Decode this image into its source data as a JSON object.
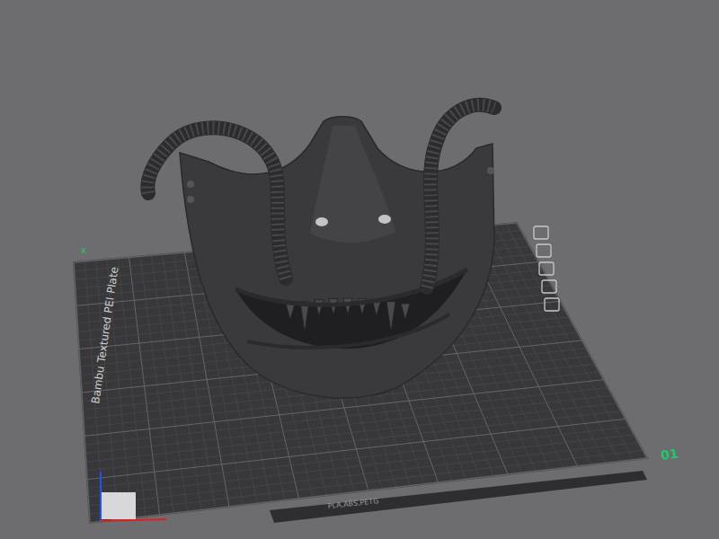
{
  "viewport": {
    "background": "#6d6d70"
  },
  "plate": {
    "name": "Bambu Textured PEI Plate",
    "number": "01",
    "filaments": "PLA,ABS,PETG",
    "axis_label": "x",
    "tools": 5
  },
  "model": {
    "name": "mask",
    "color": "#3a3a3d"
  }
}
